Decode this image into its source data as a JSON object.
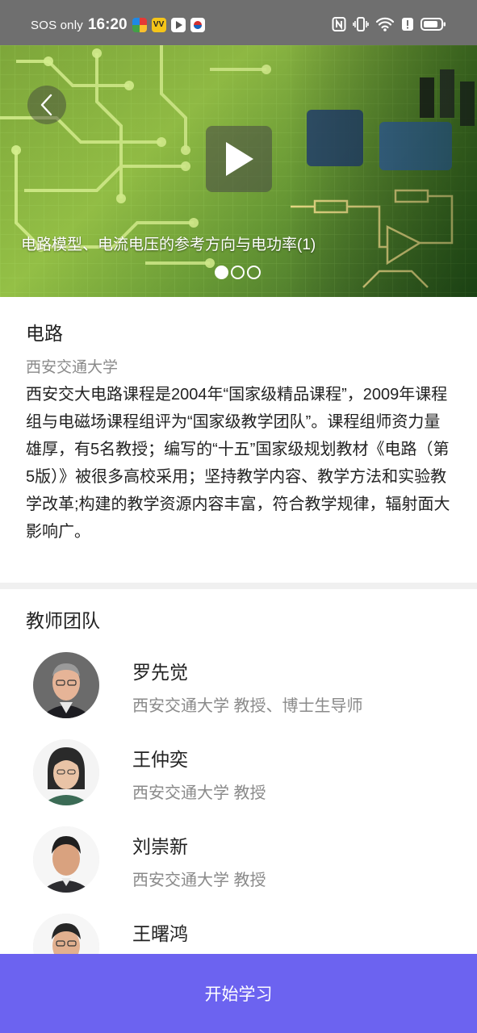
{
  "status_bar": {
    "sos": "SOS only",
    "time": "16:20",
    "app_icons": [
      "pinwheel-app-icon",
      "vv-app-icon",
      "play-app-icon",
      "taiji-app-icon"
    ],
    "right_icons": [
      "nfc-icon",
      "vibrate-icon",
      "wifi-icon",
      "alert-icon",
      "battery-icon"
    ]
  },
  "hero": {
    "video_title": "电路模型、电流电压的参考方向与电功率(1)",
    "slides": 3,
    "active_slide": 0
  },
  "course": {
    "title": "电路",
    "school": "西安交通大学",
    "description": "西安交大电路课程是2004年“国家级精品课程”，2009年课程组与电磁场课程组评为“国家级教学团队”。课程组师资力量雄厚，有5名教授；编写的“十五”国家级规划教材《电路（第5版）》被很多高校采用；坚持教学内容、教学方法和实验教学改革;构建的教学资源内容丰富，符合教学规律，辐射面大影响广。"
  },
  "team": {
    "title": "教师团队",
    "teachers": [
      {
        "name": "罗先觉",
        "desc": "西安交通大学 教授、博士生导师"
      },
      {
        "name": "王仲奕",
        "desc": "西安交通大学 教授"
      },
      {
        "name": "刘崇新",
        "desc": "西安交通大学 教授"
      },
      {
        "name": "王曙鸿",
        "desc": ""
      }
    ]
  },
  "start_button": {
    "label": "开始学习"
  },
  "colors": {
    "accent": "#6c63f0",
    "status_bar": "#6f6f6f",
    "secondary_text": "#8a8a8a"
  }
}
